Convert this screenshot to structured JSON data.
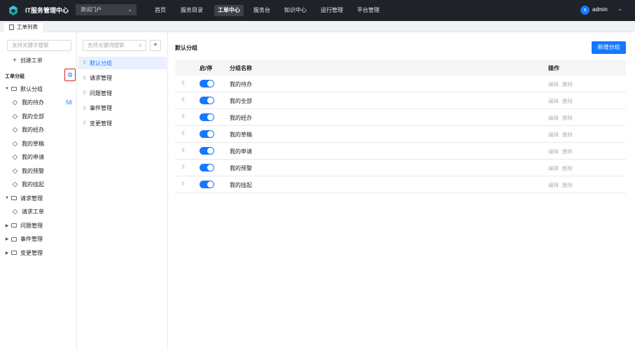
{
  "header": {
    "brand": "IT服务管理中心",
    "portal": "测试门户",
    "nav": [
      "首页",
      "服务目录",
      "工单中心",
      "服务台",
      "知识中心",
      "运行管理",
      "平台管理"
    ],
    "active_nav": "工单中心",
    "avatar_letter": "a",
    "username": "admin"
  },
  "tabbar": {
    "tab": "工单列表"
  },
  "left": {
    "search_placeholder": "支持关键字搜索",
    "create_label": "创建工单",
    "section_title": "工单分组",
    "tree": [
      {
        "label": "默认分组",
        "type": "folder",
        "expanded": true,
        "children": [
          {
            "label": "我的待办",
            "badge": "56"
          },
          {
            "label": "我的全部"
          },
          {
            "label": "我的经办"
          },
          {
            "label": "我的草稿"
          },
          {
            "label": "我的申请"
          },
          {
            "label": "我的预警"
          },
          {
            "label": "我的挂起"
          }
        ]
      },
      {
        "label": "请求管理",
        "type": "folder",
        "expanded": true,
        "children": [
          {
            "label": "请求工单"
          }
        ]
      },
      {
        "label": "问题管理",
        "type": "folder",
        "expanded": false
      },
      {
        "label": "事件管理",
        "type": "folder",
        "expanded": false
      },
      {
        "label": "变更管理",
        "type": "folder",
        "expanded": false
      }
    ]
  },
  "mid": {
    "search_placeholder": "支持关键词搜索",
    "add_label": "+",
    "groups": [
      "默认分组",
      "请求管理",
      "问题管理",
      "事件管理",
      "变更管理"
    ],
    "selected": "默认分组"
  },
  "main": {
    "title": "默认分组",
    "new_button": "新增分组",
    "columns": {
      "toggle": "启/停",
      "name": "分组名称",
      "ops": "操作"
    },
    "rows": [
      {
        "name": "我的待办",
        "enabled": true
      },
      {
        "name": "我的全部",
        "enabled": true
      },
      {
        "name": "我的经办",
        "enabled": true
      },
      {
        "name": "我的草稿",
        "enabled": true
      },
      {
        "name": "我的申请",
        "enabled": true
      },
      {
        "name": "我的预警",
        "enabled": true
      },
      {
        "name": "我的挂起",
        "enabled": true
      }
    ],
    "edit_label": "编辑",
    "delete_label": "删除"
  },
  "colors": {
    "accent": "#1677ff",
    "header_bg": "#1f2228",
    "highlight_border": "#e02020"
  }
}
